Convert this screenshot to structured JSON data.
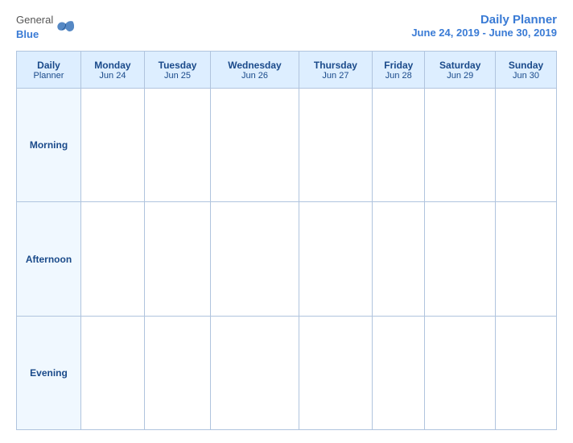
{
  "header": {
    "logo": {
      "general": "General",
      "blue": "Blue"
    },
    "title_line1": "Daily Planner",
    "title_line2": "June 24, 2019 - June 30, 2019"
  },
  "table": {
    "columns": [
      {
        "id": "label",
        "day": "Daily",
        "day2": "Planner",
        "date": ""
      },
      {
        "id": "mon",
        "day": "Monday",
        "date": "Jun 24"
      },
      {
        "id": "tue",
        "day": "Tuesday",
        "date": "Jun 25"
      },
      {
        "id": "wed",
        "day": "Wednesday",
        "date": "Jun 26"
      },
      {
        "id": "thu",
        "day": "Thursday",
        "date": "Jun 27"
      },
      {
        "id": "fri",
        "day": "Friday",
        "date": "Jun 28"
      },
      {
        "id": "sat",
        "day": "Saturday",
        "date": "Jun 29"
      },
      {
        "id": "sun",
        "day": "Sunday",
        "date": "Jun 30"
      }
    ],
    "rows": [
      {
        "label": "Morning"
      },
      {
        "label": "Afternoon"
      },
      {
        "label": "Evening"
      }
    ]
  }
}
